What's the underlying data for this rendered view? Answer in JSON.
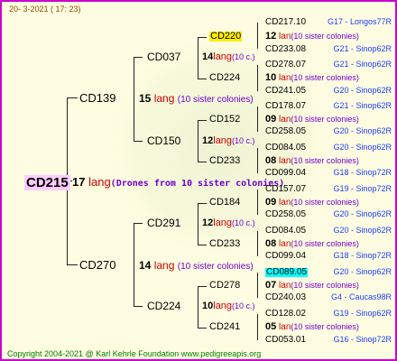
{
  "header": {
    "date": "20-   3-2021 (  17:  23)"
  },
  "root": {
    "id": "CD215",
    "num": "17",
    "lang": "lang",
    "note": "(Drones from 10 sister colonies)"
  },
  "gen1": [
    {
      "id": "CD139",
      "num": "15",
      "lang": "lang",
      "note": "(10 sister colonies)"
    },
    {
      "id": "CD270",
      "num": "14",
      "lang": "lang",
      "note": "(10 sister colonies)"
    }
  ],
  "gen2": [
    {
      "id": "CD037",
      "num": "14",
      "lang": "lang",
      "note": "(10 c.)"
    },
    {
      "id": "CD150",
      "num": "12",
      "lang": "lang",
      "note": "(10 c.)"
    },
    {
      "id": "CD291",
      "num": "12",
      "lang": "lang",
      "note": "(10 c.)"
    },
    {
      "id": "CD224",
      "num": "10",
      "lang": "lang",
      "note": "(10 c.)"
    }
  ],
  "gen3": [
    {
      "id": "CD220"
    },
    {
      "id": "CD224"
    },
    {
      "id": "CD152"
    },
    {
      "id": "CD233"
    },
    {
      "id": "CD184"
    },
    {
      "id": "CD233"
    },
    {
      "id": "CD278"
    },
    {
      "id": "CD241"
    }
  ],
  "gen4": [
    {
      "p1": "CD217.10",
      "m1": "G17 - Longos77R",
      "num": "12",
      "lang": "lan",
      "note": "(10 sister colonies)",
      "p2": "CD233.08",
      "m2": "G21 - Sinop62R"
    },
    {
      "p1": "CD278.07",
      "m1": "G21 - Sinop62R",
      "num": "10",
      "lang": "lan",
      "note": "(10 sister colonies)",
      "p2": "CD241.05",
      "m2": "G20 - Sinop62R"
    },
    {
      "p1": "CD178.07",
      "m1": "G21 - Sinop62R",
      "num": "09",
      "lang": "lan",
      "note": "(10 sister colonies)",
      "p2": "CD258.05",
      "m2": "G20 - Sinop62R"
    },
    {
      "p1": "CD084.05",
      "m1": "G20 - Sinop62R",
      "num": "08",
      "lang": "lan",
      "note": "(10 sister colonies)",
      "p2": "CD099.04",
      "m2": "G18 - Sinop72R"
    },
    {
      "p1": "CD157.07",
      "m1": "G19 - Sinop72R",
      "num": "09",
      "lang": "lan",
      "note": "(10 sister colonies)",
      "p2": "CD258.05",
      "m2": "G20 - Sinop62R"
    },
    {
      "p1": "CD084.05",
      "m1": "G20 - Sinop62R",
      "num": "08",
      "lang": "lan",
      "note": "(10 sister colonies)",
      "p2": "CD099.04",
      "m2": "G18 - Sinop72R"
    },
    {
      "p1": "CD089.05",
      "m1": "G20 - Sinop62R",
      "num": "07",
      "lang": "lan",
      "note": "(10 sister colonies)",
      "p2": "CD240.03",
      "m2": "G4 - Caucas98R"
    },
    {
      "p1": "CD128.02",
      "m1": "G19 - Sinop62R",
      "num": "05",
      "lang": "lan",
      "note": "(10 sister colonies)",
      "p2": "CD053.01",
      "m2": "G16 - Sinop72R"
    }
  ],
  "footer": {
    "text": "Copyright 2004-2021 @ Karl Kehrle Foundation     www.pedigreeapis.org"
  }
}
